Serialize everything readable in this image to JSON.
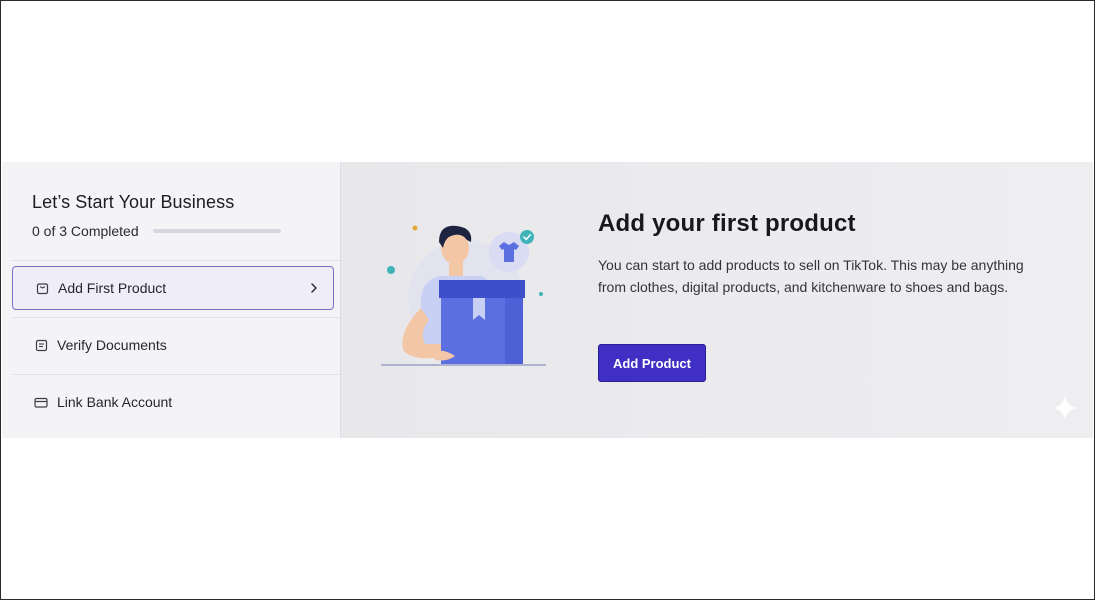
{
  "sidebar": {
    "title": "Let’s Start Your Business",
    "progress": {
      "text": "0 of 3 Completed",
      "fraction": 0
    },
    "steps": [
      {
        "label": "Add First Product",
        "icon": "shopping-bag-icon",
        "active": true
      },
      {
        "label": "Verify Documents",
        "icon": "document-icon",
        "active": false
      },
      {
        "label": "Link Bank Account",
        "icon": "credit-card-icon",
        "active": false
      }
    ]
  },
  "main": {
    "heading": "Add your first product",
    "description": "You can start to add products to sell on TikTok. This may be anything from clothes, digital products, and kitchenware to shoes and bags.",
    "button_label": "Add Product"
  },
  "colors": {
    "accent": "#3f2fc4",
    "active_border": "#7a70c9",
    "box_blue": "#5b6fe0",
    "check_teal": "#3fb3b8"
  }
}
